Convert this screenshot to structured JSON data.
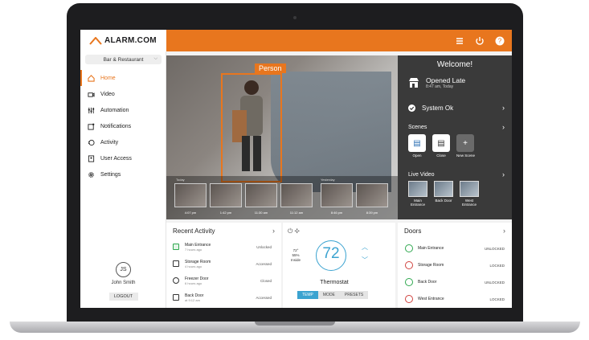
{
  "app": {
    "brand": "ALARM.COM"
  },
  "header": {
    "icons": [
      "layers-icon",
      "power-icon",
      "help-icon"
    ]
  },
  "sidebar": {
    "site": "Bar & Restaurant",
    "items": [
      {
        "label": "Home",
        "icon": "home-icon",
        "active": true
      },
      {
        "label": "Video",
        "icon": "video-icon"
      },
      {
        "label": "Automation",
        "icon": "automation-icon"
      },
      {
        "label": "Notifications",
        "icon": "bell-icon"
      },
      {
        "label": "Activity",
        "icon": "activity-icon"
      },
      {
        "label": "User Access",
        "icon": "user-access-icon"
      },
      {
        "label": "Settings",
        "icon": "gear-icon"
      }
    ],
    "user": {
      "initials": "JS",
      "name": "John Smith",
      "logout": "LOGOUT"
    }
  },
  "video": {
    "detection_label": "Person",
    "timeline_labels": [
      "Today",
      "Yesterday"
    ],
    "thumbs": [
      "4:07 pm",
      "1:42 pm",
      "11:30 am",
      "11:12 am",
      "8:46 pm",
      "8:39 pm"
    ]
  },
  "welcome": {
    "title": "Welcome!",
    "status_title": "Opened Late",
    "status_time": "8:47 am, Today",
    "system": "System Ok",
    "scenes_label": "Scenes",
    "scenes": [
      {
        "label": "Open"
      },
      {
        "label": "Close"
      },
      {
        "label": "New Scene"
      }
    ],
    "live_video_label": "Live Video",
    "cameras": [
      {
        "label": "Main Entrance"
      },
      {
        "label": "Back Door"
      },
      {
        "label": "West Entrance"
      }
    ]
  },
  "recent_activity": {
    "title": "Recent Activity",
    "rows": [
      {
        "name": "Main Entrance",
        "time": "7 hours ago",
        "status": "Unlocked"
      },
      {
        "name": "Storage Room",
        "time": "4 hours ago",
        "status": "Accessed"
      },
      {
        "name": "Freezer Door",
        "time": "6 hours ago",
        "status": "Closed"
      },
      {
        "name": "Back Door",
        "time": "at 9:12 am",
        "status": "Accessed"
      }
    ]
  },
  "thermostat": {
    "title": "Thermostat",
    "setpoint": "72",
    "inside_temp": "72°",
    "humidity": "55%",
    "inside_label": "Inside",
    "tabs": [
      "TEMP",
      "MODE",
      "PRESETS"
    ]
  },
  "doors": {
    "title": "Doors",
    "rows": [
      {
        "name": "Main Entrance",
        "state": "UNLOCKED"
      },
      {
        "name": "Storage Room",
        "state": "LOCKED"
      },
      {
        "name": "Back Door",
        "state": "UNLOCKED"
      },
      {
        "name": "West Entrance",
        "state": "LOCKED"
      }
    ]
  }
}
